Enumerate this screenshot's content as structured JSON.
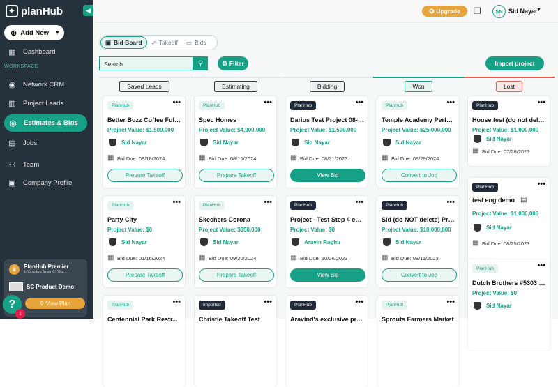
{
  "app": {
    "brand": "planHub"
  },
  "sidebar": {
    "add_new": "Add New",
    "dashboard": "Dashboard",
    "workspace": "WORKSPACE",
    "items": [
      "Network CRM",
      "Project Leads",
      "Estimates & Bids",
      "Jobs",
      "Team",
      "Company Profile"
    ],
    "premier": {
      "title": "PlanHub Premier",
      "subtitle": "100 miles from 91784",
      "demo": "SC Product Demo",
      "view_plan": "View Plan"
    },
    "help": "?",
    "help_count": "1"
  },
  "topbar": {
    "upgrade": "Upgrade",
    "avatar": "SN",
    "user": "Sid Nayar"
  },
  "toolbar": {
    "tabs": [
      "Bid Board",
      "Takeoff",
      "Bids"
    ],
    "search_placeholder": "Search",
    "filter": "Filter",
    "import": "Import project"
  },
  "columns": [
    {
      "label": "Saved Leads",
      "cards": [
        {
          "badge": "PlanHub",
          "badge_style": "light",
          "title": "Better Buzz Coffee Fuller...",
          "value": "Project Value: $1,500,000",
          "user": "Sid Nayar",
          "due": "Bid Due: 09/18/2024",
          "action": "Prepare Takeoff",
          "action_style": "outline"
        },
        {
          "badge": "PlanHub",
          "badge_style": "light",
          "title": "Party City",
          "value": "Project Value: $0",
          "user": "Sid Nayar",
          "due": "Bid Due: 01/16/2024",
          "action": "Prepare Takeoff",
          "action_style": "outline"
        },
        {
          "badge": "PlanHub",
          "badge_style": "light",
          "title": "Centennial Park Restr...",
          "value": "",
          "user": "",
          "due": "",
          "action": "",
          "action_style": "outline"
        }
      ]
    },
    {
      "label": "Estimating",
      "cards": [
        {
          "badge": "PlanHub",
          "badge_style": "light",
          "title": "Spec Homes",
          "value": "Project Value: $4,000,000",
          "user": "Sid Nayar",
          "due": "Bid Due: 08/16/2024",
          "action": "Prepare Takeoff",
          "action_style": "outline"
        },
        {
          "badge": "PlanHub",
          "badge_style": "light",
          "title": "Skechers Corona",
          "value": "Project Value: $350,000",
          "user": "Sid Nayar",
          "due": "Bid Due: 09/20/2024",
          "action": "Prepare Takeoff",
          "action_style": "outline"
        },
        {
          "badge": "Imported",
          "badge_style": "dark",
          "title": "Christie Takeoff Test",
          "value": "",
          "user": "",
          "due": "",
          "action": "",
          "action_style": "outline"
        }
      ]
    },
    {
      "label": "Bidding",
      "cards": [
        {
          "badge": "PlanHub",
          "badge_style": "dark",
          "title": "Darius Test Project 08-0...",
          "value": "Project Value: $1,500,000",
          "user": "Sid Nayar",
          "due": "Bid Due: 08/31/2023",
          "action": "View Bid",
          "action_style": "fill"
        },
        {
          "badge": "PlanHub",
          "badge_style": "dark",
          "title": "Project - Test Step 4 em...",
          "value": "Project Value: $0",
          "user": "Aravin Raghu",
          "due": "Bid Due: 10/26/2023",
          "action": "View Bid",
          "action_style": "fill"
        },
        {
          "badge": "PlanHub",
          "badge_style": "dark",
          "title": "Aravind's exclusive project",
          "value": "",
          "user": "",
          "due": "",
          "action": "",
          "action_style": "fill"
        }
      ]
    },
    {
      "label": "Won",
      "cards": [
        {
          "badge": "PlanHub",
          "badge_style": "light",
          "title": "Temple Academy Perfor...",
          "value": "Project Value: $25,000,000",
          "user": "Sid Nayar",
          "due": "Bid Due: 08/29/2024",
          "action": "Convert to Job",
          "action_style": "outline"
        },
        {
          "badge": "PlanHub",
          "badge_style": "dark",
          "title": "Sid (do NOT delete) Proj...",
          "value": "Project Value: $10,000,000",
          "user": "Sid Nayar",
          "due": "Bid Due: 08/11/2023",
          "action": "Convert to Job",
          "action_style": "outline"
        },
        {
          "badge": "PlanHub",
          "badge_style": "light",
          "title": "Sprouts Farmers Market",
          "value": "",
          "user": "",
          "due": "",
          "action": "",
          "action_style": "outline"
        }
      ]
    },
    {
      "label": "Lost",
      "cards": [
        {
          "badge": "PlanHub",
          "badge_style": "dark",
          "title": "House test (do not delete)",
          "value": "Project Value: $1,000,000",
          "user": "Sid Nayar",
          "due": "Bid Due: 07/28/2023",
          "action": "",
          "action_style": "outline"
        },
        {
          "badge": "PlanHub",
          "badge_style": "dark",
          "title": "test eng demo",
          "value": "Project Value: $1,000,000",
          "user": "Sid Nayar",
          "due": "Bid Due: 08/25/2023",
          "action": "",
          "action_style": "outline"
        },
        {
          "badge": "PlanHub",
          "badge_style": "light",
          "title": "Dutch Brothers #5303 U...",
          "value": "Project Value: $0",
          "user": "Sid Nayar",
          "due": "",
          "action": "",
          "action_style": "outline"
        }
      ]
    }
  ],
  "colors": {
    "accent": "#16a085",
    "sidebar": "#26323b",
    "gold": "#e7a43a",
    "won": "#16a085",
    "lost": "#e35d4f"
  }
}
